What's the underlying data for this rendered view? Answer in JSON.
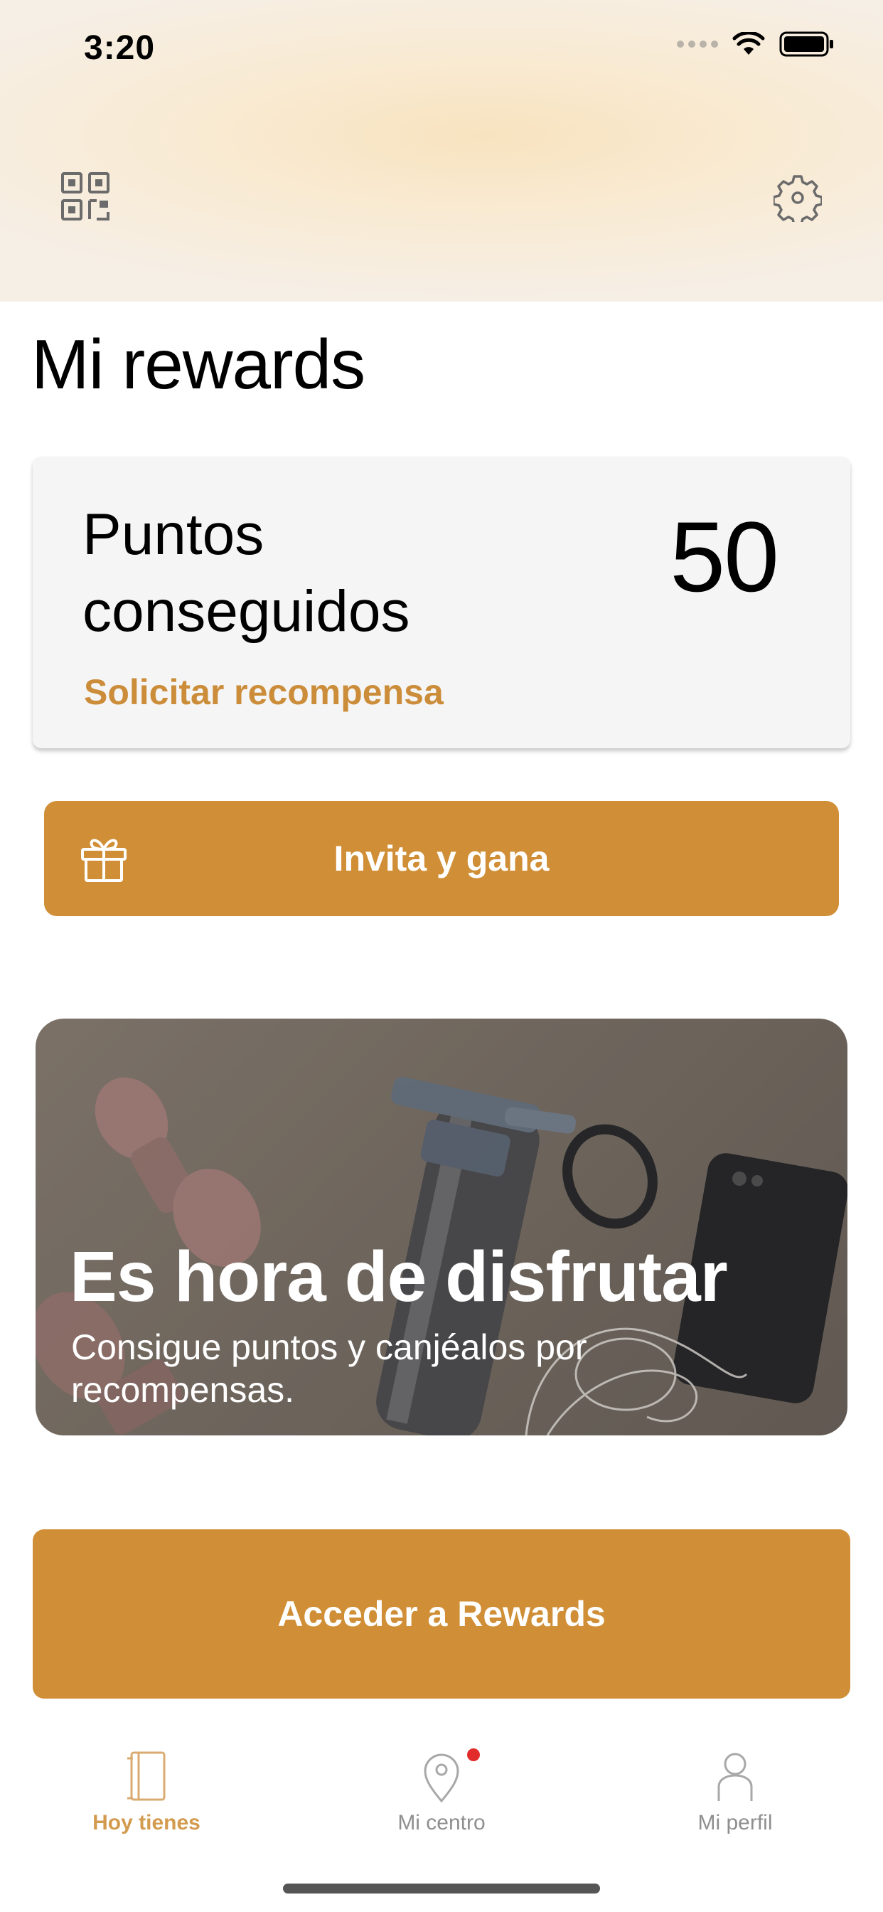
{
  "status_bar": {
    "time": "3:20",
    "icons": [
      "signal-dots-icon",
      "wifi-icon",
      "battery-icon"
    ]
  },
  "header": {
    "left_icon": "qr-code-icon",
    "right_icon": "gear-icon"
  },
  "page": {
    "title": "Mi rewards"
  },
  "points_card": {
    "label": "Puntos conseguidos",
    "value": "50",
    "link": "Solicitar recompensa"
  },
  "invite_button": {
    "label": "Invita y gana",
    "icon": "gift-icon"
  },
  "promo": {
    "title": "Es hora de disfrutar",
    "subtitle": "Consigue puntos y canjéalos por recompensas."
  },
  "rewards_button": {
    "label": "Acceder a Rewards"
  },
  "tabbar": {
    "items": [
      {
        "label": "Hoy tienes",
        "icon": "notebook-icon",
        "active": true
      },
      {
        "label": "Mi centro",
        "icon": "location-pin-icon",
        "active": false,
        "badge": true
      },
      {
        "label": "Mi perfil",
        "icon": "person-icon",
        "active": false
      }
    ]
  },
  "colors": {
    "accent": "#d08f36",
    "link": "#cc8d3a",
    "active_tab": "#d39b4f",
    "inactive_tab": "#8f8f8f",
    "badge": "#e22b2b"
  }
}
